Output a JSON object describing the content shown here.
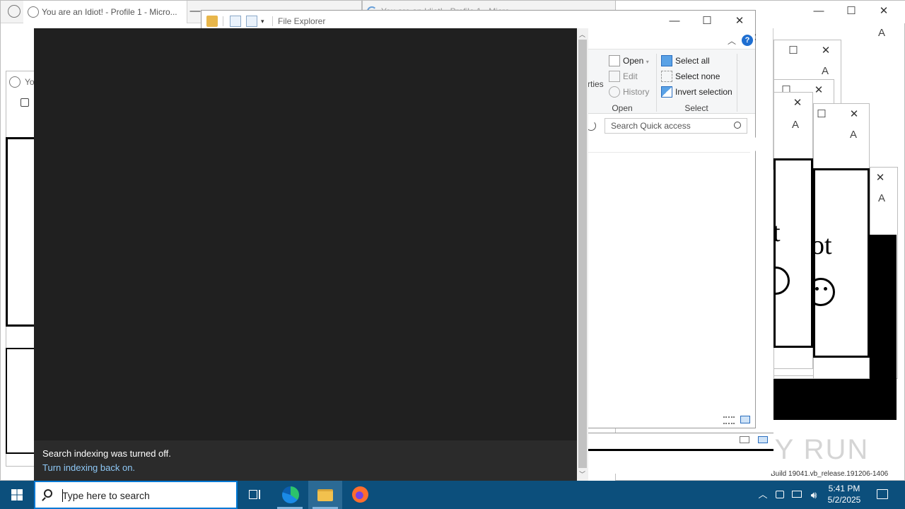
{
  "background_windows": {
    "tab_title_1": "You are an Idiot! - Profile 1 - Micro...",
    "tab_title_2": "You are an Idiot! - Profile 1 - Micro",
    "tab_title_3": "You",
    "idiot_text_1": "t",
    "idiot_text_2": "ot"
  },
  "explorer": {
    "title": "File Explorer",
    "ribbon": {
      "properties_partial": "rties",
      "open": "Open",
      "edit": "Edit",
      "history": "History",
      "open_group": "Open",
      "select_all": "Select all",
      "select_none": "Select none",
      "invert_selection": "Invert selection",
      "select_group": "Select"
    },
    "search_placeholder": "Search Quick access"
  },
  "search_panel": {
    "notice_title": "Search indexing was turned off.",
    "notice_link": "Turn indexing back on."
  },
  "watermark": {
    "brand": "ANY RUN",
    "build": "Build 19041.vb_release.191206-1406"
  },
  "taskbar": {
    "search_placeholder": "Type here to search",
    "time": "5:41 PM",
    "date": "5/2/2025"
  },
  "colors": {
    "taskbar": "#0c4f7c",
    "panel": "#202020",
    "link": "#8ec8f6",
    "accent": "#0078d4"
  }
}
